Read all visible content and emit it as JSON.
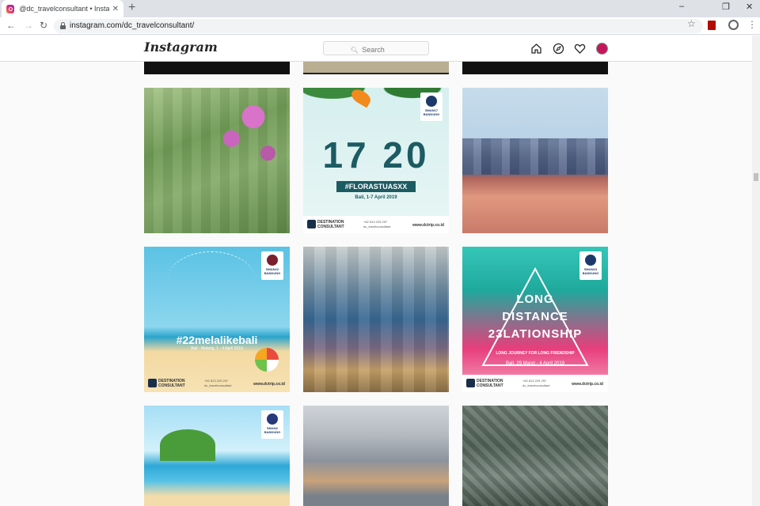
{
  "browser": {
    "tab_title": "@dc_travelconsultant • Instagram",
    "tab_close": "✕",
    "new_tab": "+",
    "url": "instagram.com/dc_travelconsultant/",
    "window_controls": [
      "–",
      "❐",
      "✕"
    ]
  },
  "instagram": {
    "logo": "Instagram",
    "search_placeholder": "Search"
  },
  "posts": {
    "p2": {
      "badge_name": "SMAN17",
      "badge_city": "BANDUNG",
      "headline": "17 20",
      "hashtag": "#FLORASTUASXX",
      "subline": "Bali, 1-7 April 2019"
    },
    "p4": {
      "badge_name": "SMAN22",
      "badge_city": "BANDUNG",
      "hashtag": "#22melalikebali",
      "subline": "Bali - Malang, 1 - 4 April 2019"
    },
    "p6": {
      "badge_name": "SMAN23",
      "badge_city": "BANDUNG",
      "line1": "LONG",
      "line2": "DISTANCE",
      "line3": "23LATIONSHIP",
      "tagline": "LONG JOURNEY FOR LONG FRIENDSHIP",
      "subline": "Bali, 29 Maret - 4 April 2019"
    },
    "p7": {
      "badge_name": "SMAN2",
      "badge_city": "BANDUNG"
    }
  },
  "footer": {
    "brand_line1": "DESTINATION",
    "brand_line2": "CONSULTANT",
    "phone": "+62 813 225 297",
    "handle": "dc_travelconsultant",
    "website": "www.dctrip.co.id"
  }
}
